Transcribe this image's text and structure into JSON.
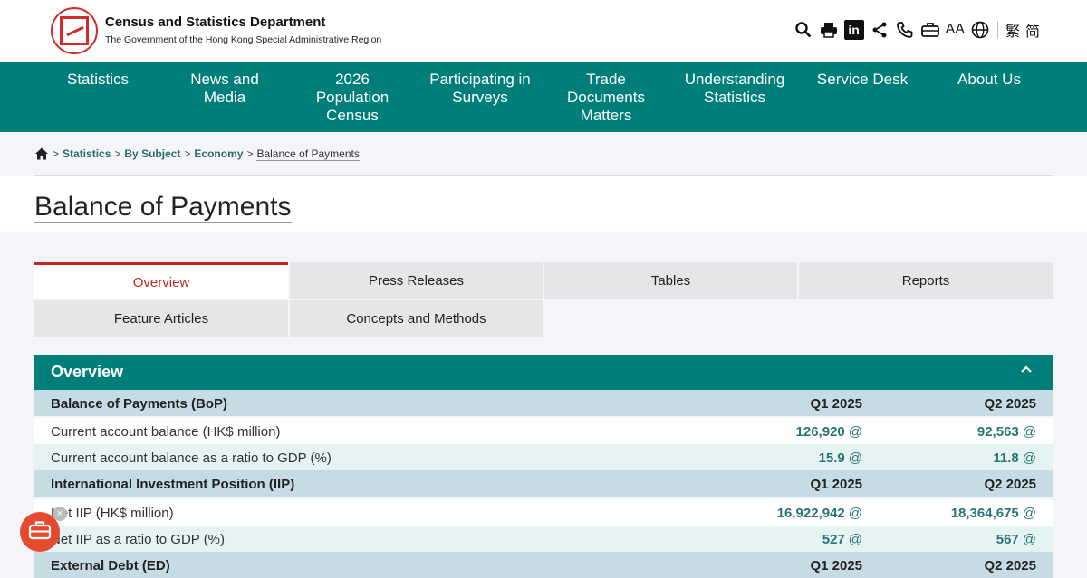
{
  "header": {
    "dept_name": "Census and Statistics Department",
    "dept_sub": "The Government of the Hong Kong Special Administrative Region",
    "tools": {
      "font_size": "AA",
      "trad": "繁",
      "simp": "简"
    }
  },
  "nav": [
    {
      "label": "Statistics"
    },
    {
      "label": "News and\nMedia"
    },
    {
      "label": "2026\nPopulation\nCensus"
    },
    {
      "label": "Participating in\nSurveys"
    },
    {
      "label": "Trade\nDocuments\nMatters"
    },
    {
      "label": "Understanding\nStatistics"
    },
    {
      "label": "Service Desk"
    },
    {
      "label": "About Us"
    }
  ],
  "breadcrumb": {
    "sep": ">",
    "items": [
      "Statistics",
      "By Subject",
      "Economy"
    ],
    "current": "Balance of Payments"
  },
  "page_title": "Balance of Payments",
  "tabs": [
    "Overview",
    "Press Releases",
    "Tables",
    "Reports",
    "Feature Articles",
    "Concepts and Methods"
  ],
  "panel": {
    "title": "Overview",
    "rows": [
      {
        "type": "head",
        "label": "Balance of Payments (BoP)",
        "c1": "Q1 2025",
        "c2": "Q2 2025"
      },
      {
        "type": "w",
        "label": "Current account balance (HK$ million)",
        "c1": "126,920",
        "c2": "92,563",
        "mark": "@"
      },
      {
        "type": "l",
        "label": "Current account balance as a ratio to GDP (%)",
        "c1": "15.9",
        "c2": "11.8",
        "mark": "@"
      },
      {
        "type": "head",
        "label": "International Investment Position (IIP)",
        "c1": "Q1 2025",
        "c2": "Q2 2025"
      },
      {
        "type": "w",
        "label": "Net IIP (HK$ million)",
        "c1": "16,922,942",
        "c2": "18,364,675",
        "mark": "@"
      },
      {
        "type": "l",
        "label": "Net IIP as a ratio to GDP (%)",
        "c1": "527",
        "c2": "567",
        "mark": "@"
      },
      {
        "type": "head",
        "label": "External Debt (ED)",
        "c1": "Q1 2025",
        "c2": "Q2 2025"
      }
    ]
  },
  "float": {
    "close": "×"
  }
}
